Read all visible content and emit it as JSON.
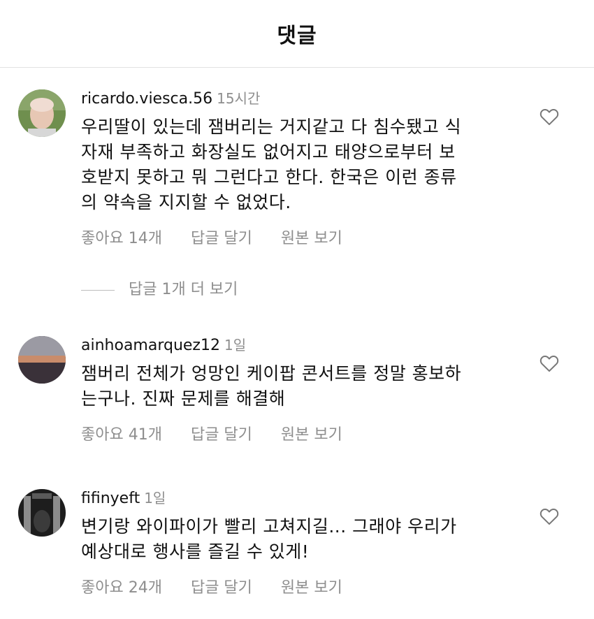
{
  "header": {
    "title": "댓글"
  },
  "comments": [
    {
      "username": "ricardo.viesca.56",
      "time": "15시간",
      "lines": [
        "우리딸이 있는데 잼버리는 거지같고 다 침수됐고 식",
        "자재 부족하고 화장실도 없어지고 태양으로부터 보",
        "호받지 못하고 뭐 그런다고 한다. 한국은 이런 종류",
        "의 약속을 지지할 수 없었다."
      ],
      "likes": "좋아요 14개",
      "reply": "답글 달기",
      "original": "원본 보기"
    },
    {
      "username": "ainhoamarquez12",
      "time": "1일",
      "lines": [
        "잼버리 전체가 엉망인 케이팝 콘서트를 정말 홍보하",
        "는구나. 진짜 문제를 해결해"
      ],
      "likes": "좋아요 41개",
      "reply": "답글 달기",
      "original": "원본 보기"
    },
    {
      "username": "fifinyeft",
      "time": "1일",
      "lines": [
        "변기랑 와이파이가 빨리 고쳐지길... 그래야 우리가",
        "예상대로 행사를 즐길 수 있게!"
      ],
      "likes": "좋아요 24개",
      "reply": "답글 달기",
      "original": "원본 보기"
    }
  ],
  "more_replies": "답글 1개 더 보기",
  "icons": {
    "like": "heart-outline-icon"
  },
  "colors": {
    "secondary_text": "#8e8e8e",
    "divider": "#e2e2e2"
  }
}
